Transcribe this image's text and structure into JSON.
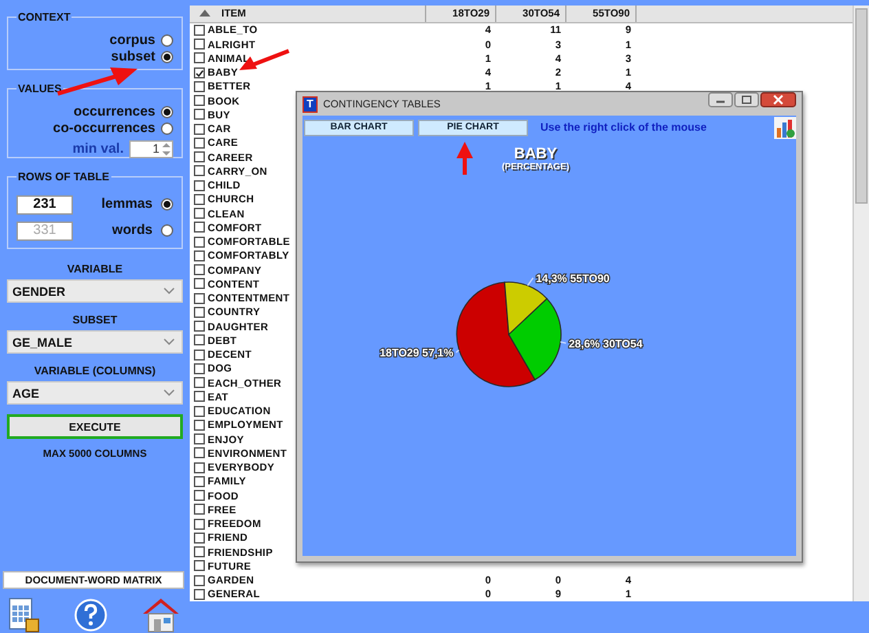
{
  "context": {
    "title": "CONTEXT",
    "options": [
      {
        "label": "corpus",
        "selected": false
      },
      {
        "label": "subset",
        "selected": true
      }
    ]
  },
  "values": {
    "title": "VALUES",
    "options": [
      {
        "label": "occurrences",
        "selected": true
      },
      {
        "label": "co-occurrences",
        "selected": false
      }
    ],
    "min_val": {
      "label": "min val.",
      "value": "1"
    }
  },
  "rows_of_table": {
    "title": "ROWS OF TABLE",
    "options": [
      {
        "count": "231",
        "label": "lemmas",
        "selected": true
      },
      {
        "count": "331",
        "label": "words",
        "selected": false
      }
    ]
  },
  "dropdowns": [
    {
      "label": "VARIABLE",
      "value": "GENDER"
    },
    {
      "label": "SUBSET",
      "value": "GE_MALE"
    },
    {
      "label": "VARIABLE (COLUMNS)",
      "value": "AGE"
    }
  ],
  "execute_button": "EXECUTE",
  "max_note": "MAX 5000 COLUMNS",
  "matrix_button": "DOCUMENT-WORD MATRIX",
  "table": {
    "columns": [
      "ITEM",
      "18TO29",
      "30TO54",
      "55TO90"
    ],
    "rows": [
      {
        "item": "ABLE_TO",
        "checked": false,
        "values": [
          "4",
          "11",
          "9"
        ]
      },
      {
        "item": "ALRIGHT",
        "checked": false,
        "values": [
          "0",
          "3",
          "1"
        ]
      },
      {
        "item": "ANIMAL",
        "checked": false,
        "values": [
          "1",
          "4",
          "3"
        ]
      },
      {
        "item": "BABY",
        "checked": true,
        "values": [
          "4",
          "2",
          "1"
        ]
      },
      {
        "item": "BETTER",
        "checked": false,
        "values": [
          "1",
          "1",
          "4"
        ]
      },
      {
        "item": "BOOK",
        "checked": false
      },
      {
        "item": "BUY",
        "checked": false
      },
      {
        "item": "CAR",
        "checked": false
      },
      {
        "item": "CARE",
        "checked": false
      },
      {
        "item": "CAREER",
        "checked": false
      },
      {
        "item": "CARRY_ON",
        "checked": false
      },
      {
        "item": "CHILD",
        "checked": false
      },
      {
        "item": "CHURCH",
        "checked": false
      },
      {
        "item": "CLEAN",
        "checked": false
      },
      {
        "item": "COMFORT",
        "checked": false
      },
      {
        "item": "COMFORTABLE",
        "checked": false
      },
      {
        "item": "COMFORTABLY",
        "checked": false
      },
      {
        "item": "COMPANY",
        "checked": false
      },
      {
        "item": "CONTENT",
        "checked": false
      },
      {
        "item": "CONTENTMENT",
        "checked": false
      },
      {
        "item": "COUNTRY",
        "checked": false
      },
      {
        "item": "DAUGHTER",
        "checked": false
      },
      {
        "item": "DEBT",
        "checked": false
      },
      {
        "item": "DECENT",
        "checked": false
      },
      {
        "item": "DOG",
        "checked": false
      },
      {
        "item": "EACH_OTHER",
        "checked": false
      },
      {
        "item": "EAT",
        "checked": false
      },
      {
        "item": "EDUCATION",
        "checked": false
      },
      {
        "item": "EMPLOYMENT",
        "checked": false
      },
      {
        "item": "ENJOY",
        "checked": false
      },
      {
        "item": "ENVIRONMENT",
        "checked": false
      },
      {
        "item": "EVERYBODY",
        "checked": false
      },
      {
        "item": "FAMILY",
        "checked": false
      },
      {
        "item": "FOOD",
        "checked": false
      },
      {
        "item": "FREE",
        "checked": false
      },
      {
        "item": "FREEDOM",
        "checked": false
      },
      {
        "item": "FRIEND",
        "checked": false
      },
      {
        "item": "FRIENDSHIP",
        "checked": false
      },
      {
        "item": "FUTURE",
        "checked": false
      },
      {
        "item": "GARDEN",
        "checked": false,
        "values": [
          "0",
          "0",
          "4"
        ]
      },
      {
        "item": "GENERAL",
        "checked": false,
        "values": [
          "0",
          "9",
          "1"
        ]
      }
    ]
  },
  "window": {
    "icon_letter": "T",
    "title": "CONTINGENCY TABLES",
    "buttons": [
      "BAR CHART",
      "PIE CHART"
    ],
    "hint": "Use the right click of the mouse",
    "chart": {
      "subtitle": "(PERCENTAGE)",
      "chart_data": {
        "type": "pie",
        "title": "BABY",
        "categories": [
          "18TO29",
          "30TO54",
          "55TO90"
        ],
        "values": [
          57.1,
          28.6,
          14.3
        ],
        "colors": [
          "#cc0000",
          "#00cc00",
          "#cccc00"
        ],
        "value_labels": [
          "57,1%",
          "28,6%",
          "14,3%"
        ]
      }
    }
  }
}
